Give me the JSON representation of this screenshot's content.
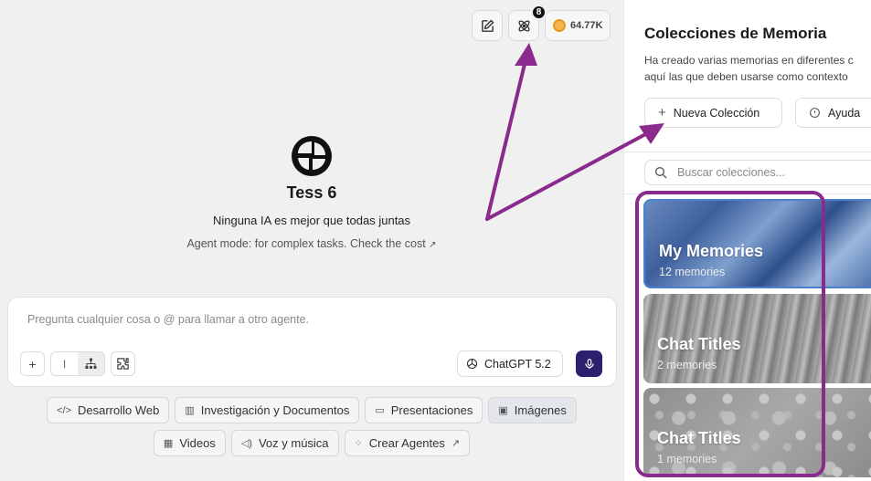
{
  "top_actions": {
    "badge_count": "8",
    "credits": "64.77K"
  },
  "hero": {
    "title": "Tess 6",
    "subtitle": "Ninguna IA es mejor que todas juntas",
    "note": "Agent mode: for complex tasks. Check the cost",
    "note_icon": "external-link-icon"
  },
  "composer": {
    "placeholder": "Pregunta cualquier cosa o @ para llamar a otro agente.",
    "model": "ChatGPT 5.2",
    "mic_color": "#2e1e6e"
  },
  "chips": {
    "row1": [
      {
        "label": "Desarrollo Web",
        "icon": "code-icon",
        "glyph": "</>"
      },
      {
        "label": "Investigación y Documentos",
        "icon": "books-icon",
        "glyph": "▥"
      },
      {
        "label": "Presentaciones",
        "icon": "presentation-icon",
        "glyph": "▭"
      },
      {
        "label": "Imágenes",
        "icon": "image-icon",
        "glyph": "▣",
        "active": true
      }
    ],
    "row2": [
      {
        "label": "Videos",
        "icon": "film-icon",
        "glyph": "▦"
      },
      {
        "label": "Voz y música",
        "icon": "speaker-icon",
        "glyph": "◁)"
      },
      {
        "label": "Crear Agentes",
        "icon": "agents-icon",
        "glyph": "⁘",
        "suffix": "↗"
      }
    ]
  },
  "panel": {
    "title": "Colecciones de Memoria",
    "desc_line1": "Ha creado varias memorias en diferentes c",
    "desc_line2": "aquí las que deben usarse como contexto",
    "new_button": "Nueva Colección",
    "help_button": "Ayuda",
    "search_placeholder": "Buscar colecciones...",
    "collections": [
      {
        "title": "My Memories",
        "count": "12 memories"
      },
      {
        "title": "Chat Titles",
        "count": "2 memories"
      },
      {
        "title": "Chat Titles",
        "count": "1 memories"
      }
    ]
  },
  "annotation": {
    "color": "#8a2a8c"
  }
}
